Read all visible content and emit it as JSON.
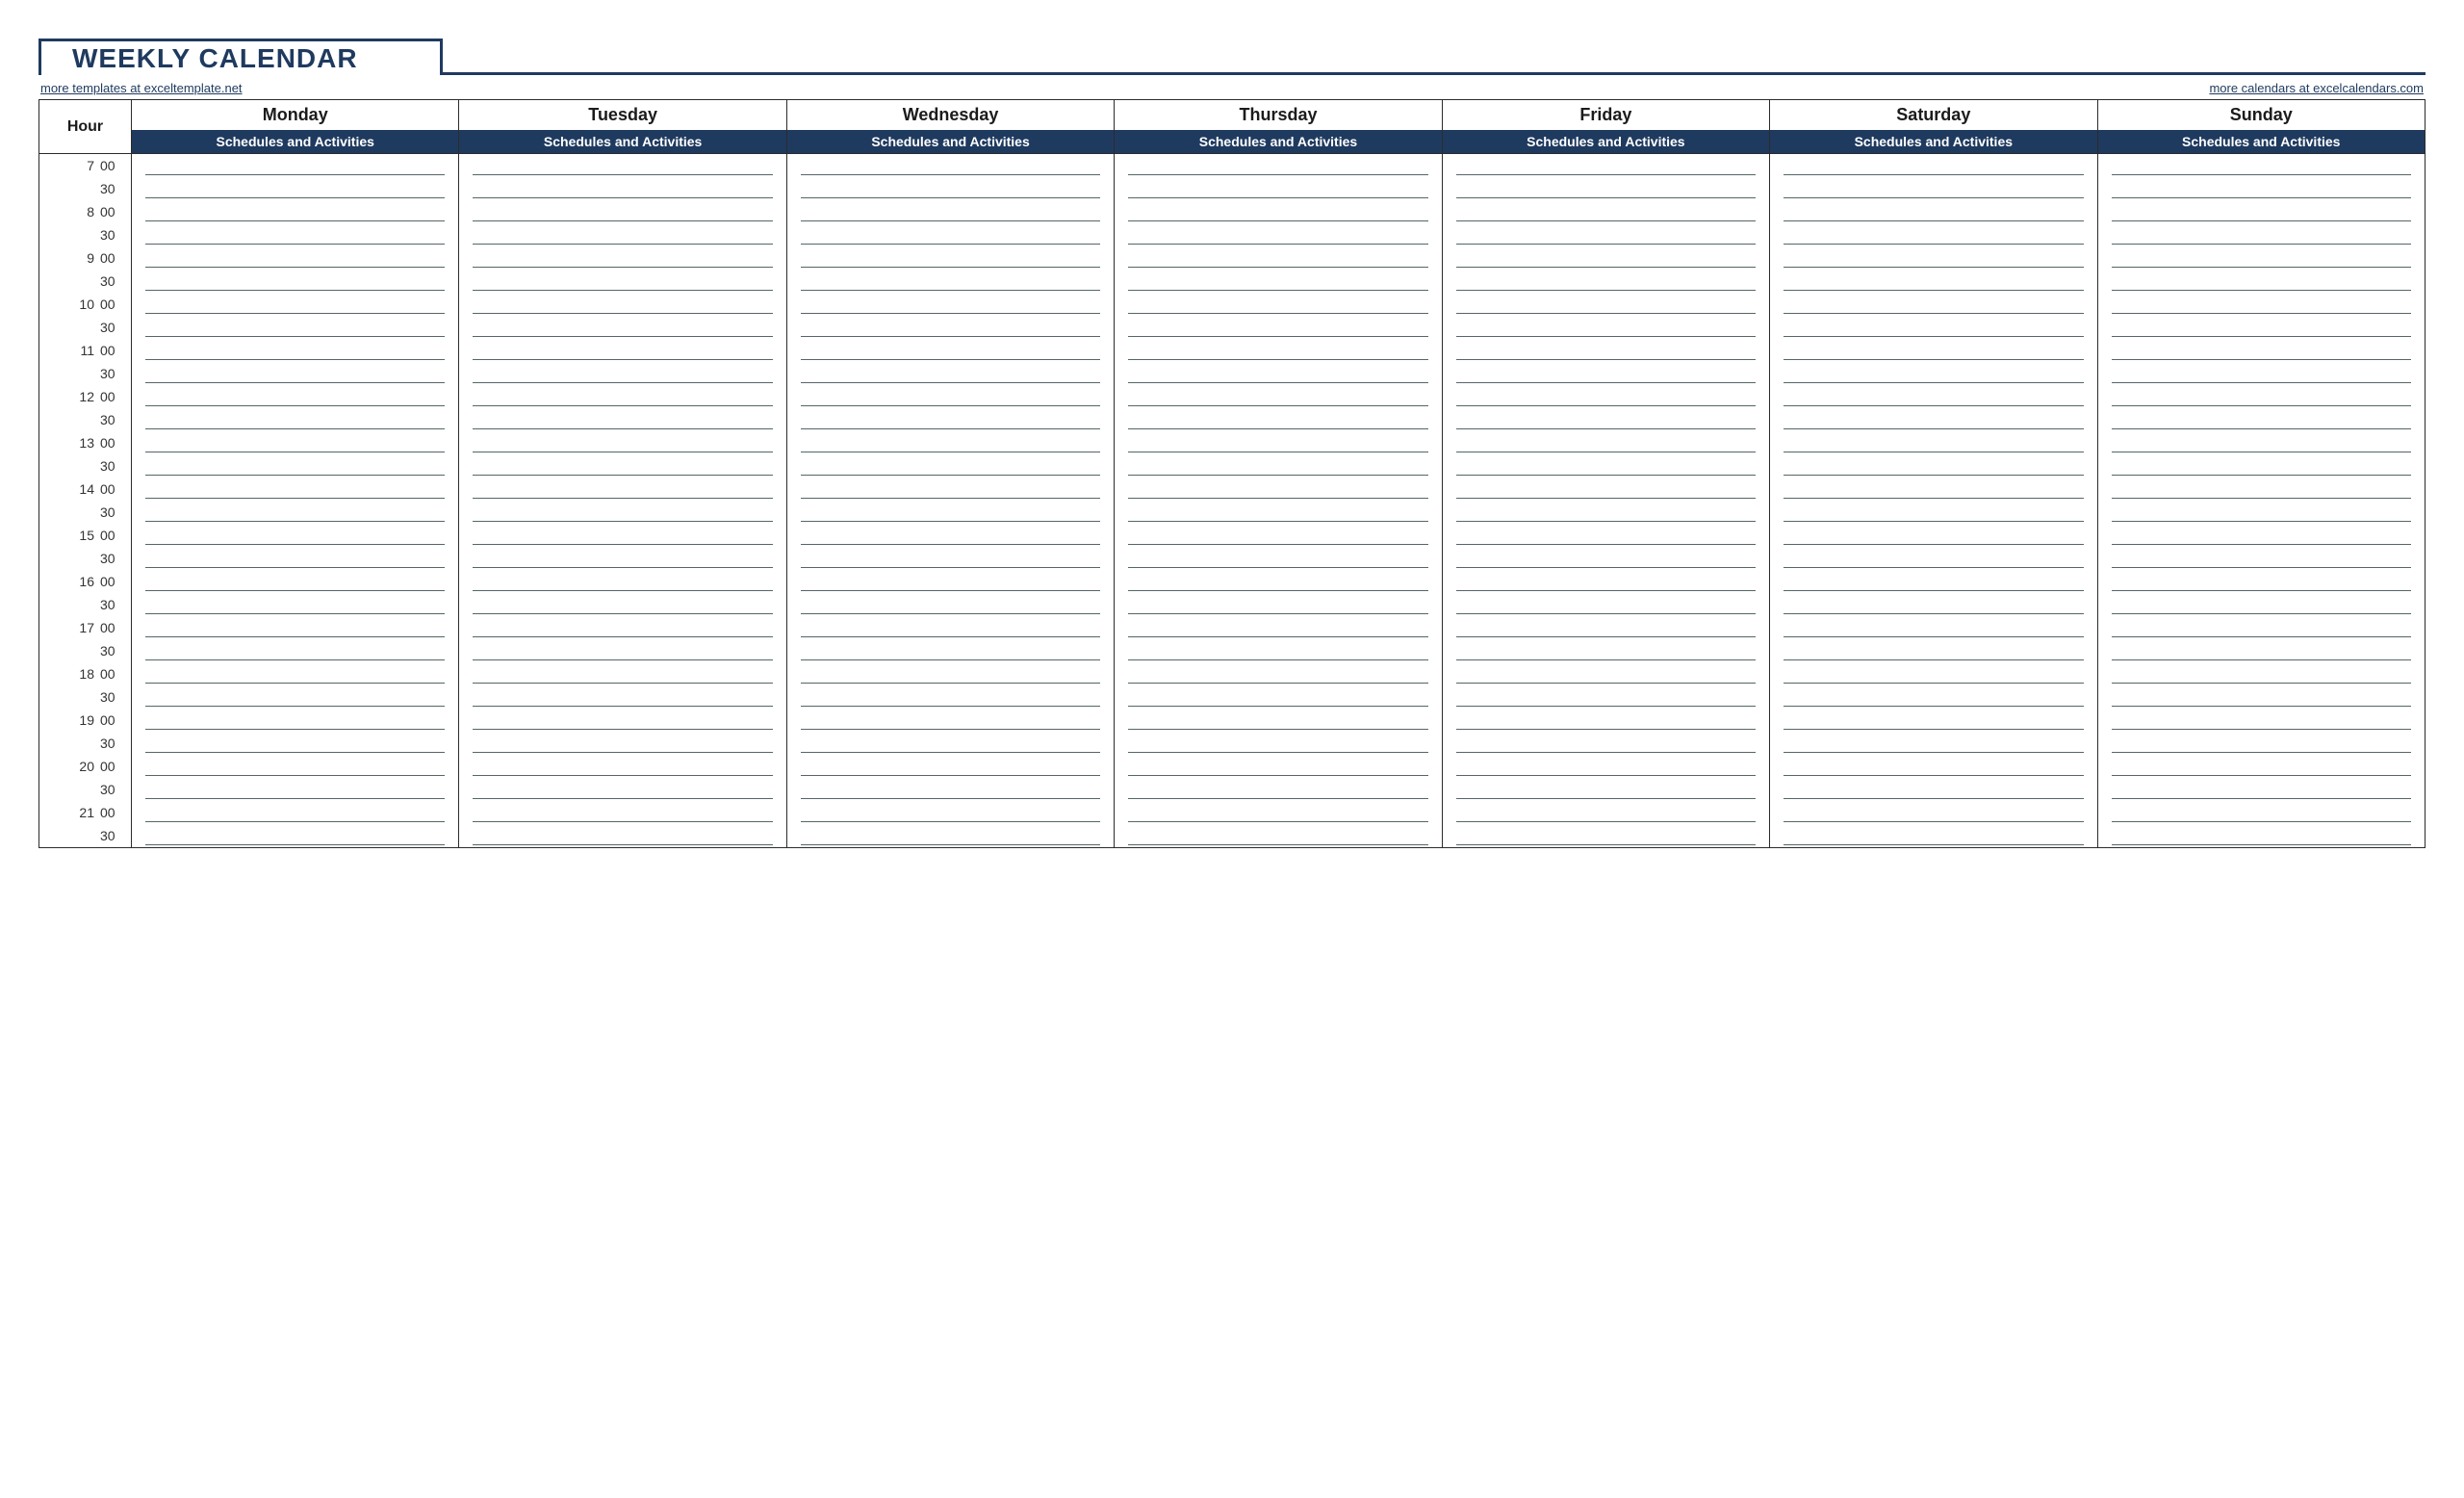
{
  "title": "WEEKLY CALENDAR",
  "link_left": "more templates at exceltemplate.net",
  "link_right": "more calendars at excelcalendars.com",
  "hour_header": "Hour",
  "days": [
    {
      "name": "Monday",
      "sub": "Schedules and Activities"
    },
    {
      "name": "Tuesday",
      "sub": "Schedules and Activities"
    },
    {
      "name": "Wednesday",
      "sub": "Schedules and Activities"
    },
    {
      "name": "Thursday",
      "sub": "Schedules and Activities"
    },
    {
      "name": "Friday",
      "sub": "Schedules and Activities"
    },
    {
      "name": "Saturday",
      "sub": "Schedules and Activities"
    },
    {
      "name": "Sunday",
      "sub": "Schedules and Activities"
    }
  ],
  "time_slots": [
    {
      "hour": "7",
      "minute": "00"
    },
    {
      "hour": "",
      "minute": "30"
    },
    {
      "hour": "8",
      "minute": "00"
    },
    {
      "hour": "",
      "minute": "30"
    },
    {
      "hour": "9",
      "minute": "00"
    },
    {
      "hour": "",
      "minute": "30"
    },
    {
      "hour": "10",
      "minute": "00"
    },
    {
      "hour": "",
      "minute": "30"
    },
    {
      "hour": "11",
      "minute": "00"
    },
    {
      "hour": "",
      "minute": "30"
    },
    {
      "hour": "12",
      "minute": "00"
    },
    {
      "hour": "",
      "minute": "30"
    },
    {
      "hour": "13",
      "minute": "00"
    },
    {
      "hour": "",
      "minute": "30"
    },
    {
      "hour": "14",
      "minute": "00"
    },
    {
      "hour": "",
      "minute": "30"
    },
    {
      "hour": "15",
      "minute": "00"
    },
    {
      "hour": "",
      "minute": "30"
    },
    {
      "hour": "16",
      "minute": "00"
    },
    {
      "hour": "",
      "minute": "30"
    },
    {
      "hour": "17",
      "minute": "00"
    },
    {
      "hour": "",
      "minute": "30"
    },
    {
      "hour": "18",
      "minute": "00"
    },
    {
      "hour": "",
      "minute": "30"
    },
    {
      "hour": "19",
      "minute": "00"
    },
    {
      "hour": "",
      "minute": "30"
    },
    {
      "hour": "20",
      "minute": "00"
    },
    {
      "hour": "",
      "minute": "30"
    },
    {
      "hour": "21",
      "minute": "00"
    },
    {
      "hour": "",
      "minute": "30"
    }
  ]
}
